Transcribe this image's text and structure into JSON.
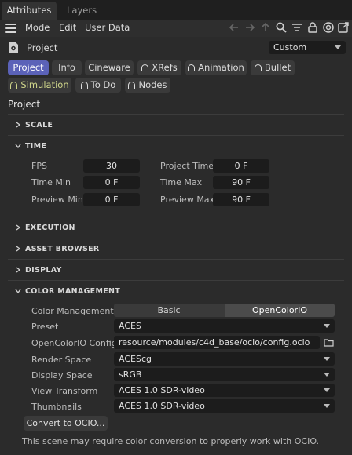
{
  "tabs": [
    "Attributes",
    "Layers"
  ],
  "menu": {
    "mode": "Mode",
    "edit": "Edit",
    "user_data": "User Data"
  },
  "object": {
    "name": "Project",
    "preset_dropdown": "Custom"
  },
  "category_tabs": [
    "Project",
    "Info",
    "Cineware",
    "XRefs",
    "Animation",
    "Bullet",
    "Simulation",
    "To Do",
    "Nodes"
  ],
  "section_title": "Project",
  "groups": {
    "scale": "SCALE",
    "time": "TIME",
    "execution": "EXECUTION",
    "asset_browser": "ASSET BROWSER",
    "display": "DISPLAY",
    "color_management": "COLOR MANAGEMENT"
  },
  "time": {
    "fps_label": "FPS",
    "fps": "30",
    "project_time_label": "Project Time",
    "project_time": "0 F",
    "time_min_label": "Time Min",
    "time_min": "0 F",
    "time_max_label": "Time Max",
    "time_max": "90 F",
    "preview_min_label": "Preview Min",
    "preview_min": "0 F",
    "preview_max_label": "Preview Max",
    "preview_max": "90 F"
  },
  "color": {
    "mode_label": "Color Management",
    "mode_options": [
      "Basic",
      "OpenColorIO"
    ],
    "preset_label": "Preset",
    "preset": "ACES",
    "config_label": "OpenColorIO Config",
    "config": "resource/modules/c4d_base/ocio/config.ocio",
    "render_label": "Render Space",
    "render": "ACEScg",
    "display_label": "Display Space",
    "display": "sRGB",
    "view_label": "View Transform",
    "view": "ACES 1.0 SDR-video",
    "thumb_label": "Thumbnails",
    "thumb": "ACES 1.0 SDR-video"
  },
  "convert_button": "Convert to OCIO...",
  "note": "This scene may require color conversion to properly work with OCIO."
}
